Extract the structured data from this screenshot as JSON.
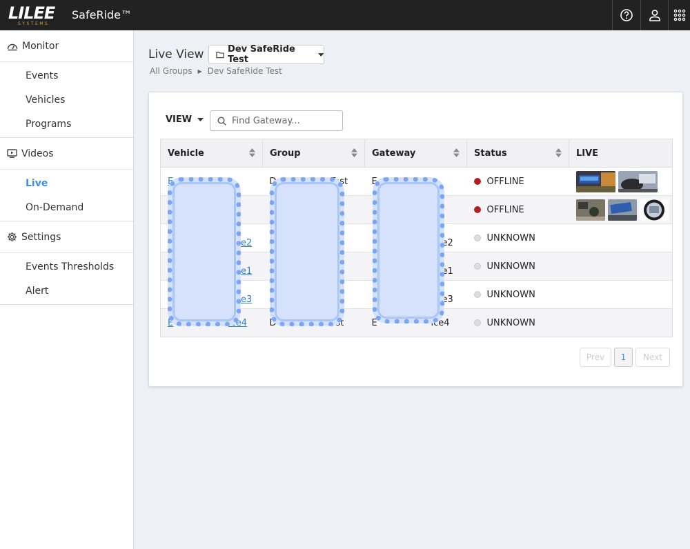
{
  "header": {
    "logo_text": "LILEE",
    "logo_sub": "SYSTEMS",
    "app_title": "SafeRide™",
    "icons": [
      "help-icon",
      "user-icon",
      "apps-grid-icon"
    ]
  },
  "sidebar": {
    "sections": [
      {
        "label": "Monitor",
        "icon": "gauge-icon",
        "items": [
          "Events",
          "Vehicles",
          "Programs"
        ]
      },
      {
        "label": "Videos",
        "icon": "video-icon",
        "items": [
          "Live",
          "On-Demand"
        ]
      },
      {
        "label": "Settings",
        "icon": "gear-icon",
        "items": [
          "Events Thresholds",
          "Alert"
        ]
      }
    ],
    "active_item": "Live"
  },
  "page": {
    "title": "Live View",
    "group_select": "Dev SafeRide Test",
    "breadcrumb": [
      "All Groups",
      "Dev SafeRide Test"
    ]
  },
  "toolbar": {
    "view_label": "VIEW",
    "search_placeholder": "Find Gateway..."
  },
  "table": {
    "columns": [
      "Vehicle",
      "Group",
      "Gateway",
      "Status",
      "LIVE"
    ],
    "rows": [
      {
        "vehicle": "E",
        "group": "D",
        "group_tail": "Test",
        "gateway": "E",
        "gateway_tail": "",
        "status": "OFFLINE",
        "thumbs": 2
      },
      {
        "vehicle": "",
        "group": "",
        "group_tail": "st",
        "gateway": "",
        "gateway_tail": "",
        "status": "OFFLINE",
        "thumbs": 3
      },
      {
        "vehicle": "",
        "vehicle_tail": "e2",
        "group": "",
        "group_tail": "st",
        "gateway": "",
        "gateway_tail": "e2",
        "status": "UNKNOWN",
        "thumbs": 0
      },
      {
        "vehicle": "",
        "vehicle_tail": "e1",
        "group": "",
        "group_tail": "st",
        "gateway": "",
        "gateway_tail": "e1",
        "status": "UNKNOWN",
        "thumbs": 0
      },
      {
        "vehicle": "",
        "vehicle_tail": "e3",
        "group": "",
        "group_tail": "st",
        "gateway": "",
        "gateway_tail": "e3",
        "status": "UNKNOWN",
        "thumbs": 0
      },
      {
        "vehicle": "E",
        "vehicle_tail": "ice4",
        "group": "D",
        "group_tail": "st",
        "gateway": "E",
        "gateway_tail": "ice4",
        "status": "UNKNOWN",
        "thumbs": 0
      }
    ]
  },
  "pagination": {
    "prev": "Prev",
    "current": "1",
    "next": "Next"
  },
  "colors": {
    "topbar": "#222222",
    "accent": "#3b8de0",
    "offline": "#b02020",
    "unknown": "#dddddd"
  }
}
